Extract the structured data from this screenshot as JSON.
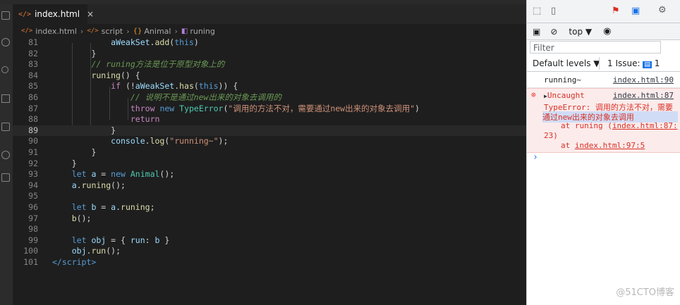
{
  "editor": {
    "tab": {
      "icon": "</>",
      "label": "index.html",
      "close": "×"
    },
    "breadcrumb": [
      {
        "icon": "</>",
        "label": "index.html"
      },
      {
        "icon": "</>",
        "label": "script"
      },
      {
        "icon": "{}",
        "label": "Animal"
      },
      {
        "icon": "◧",
        "label": "runing"
      }
    ],
    "lines": [
      {
        "n": "81",
        "ind": 6,
        "tokens": [
          [
            "var",
            "aWeakSet"
          ],
          [
            "pun",
            "."
          ],
          [
            "fn",
            "add"
          ],
          [
            "pun",
            "("
          ],
          [
            "kw",
            "this"
          ],
          [
            "pun",
            ")"
          ]
        ]
      },
      {
        "n": "82",
        "ind": 4,
        "tokens": [
          [
            "pun",
            "}"
          ]
        ]
      },
      {
        "n": "83",
        "ind": 4,
        "tokens": [
          [
            "cmt",
            "// runing方法是位于原型对象上的"
          ]
        ]
      },
      {
        "n": "84",
        "ind": 4,
        "tokens": [
          [
            "fn",
            "runing"
          ],
          [
            "pun",
            "() {"
          ]
        ]
      },
      {
        "n": "85",
        "ind": 6,
        "tokens": [
          [
            "ctl",
            "if"
          ],
          [
            "pun",
            " (!"
          ],
          [
            "var",
            "aWeakSet"
          ],
          [
            "pun",
            "."
          ],
          [
            "fn",
            "has"
          ],
          [
            "pun",
            "("
          ],
          [
            "kw",
            "this"
          ],
          [
            "pun",
            ")) {"
          ]
        ]
      },
      {
        "n": "86",
        "ind": 8,
        "tokens": [
          [
            "cmt",
            "// 说明不是通过new出来的对象去调用的"
          ]
        ]
      },
      {
        "n": "87",
        "ind": 8,
        "tokens": [
          [
            "ctl",
            "throw"
          ],
          [
            "pun",
            " "
          ],
          [
            "kw",
            "new"
          ],
          [
            "pun",
            " "
          ],
          [
            "cls",
            "TypeError"
          ],
          [
            "pun",
            "("
          ],
          [
            "str",
            "\"调用的方法不对，需要通过new出来的对象去调用\""
          ],
          [
            "pun",
            ")"
          ]
        ]
      },
      {
        "n": "88",
        "ind": 8,
        "tokens": [
          [
            "ctl",
            "return"
          ]
        ]
      },
      {
        "n": "89",
        "ind": 6,
        "tokens": [
          [
            "pun",
            "}"
          ]
        ],
        "current": true
      },
      {
        "n": "90",
        "ind": 6,
        "tokens": [
          [
            "var",
            "console"
          ],
          [
            "pun",
            "."
          ],
          [
            "fn",
            "log"
          ],
          [
            "pun",
            "("
          ],
          [
            "str",
            "\"running~\""
          ],
          [
            "pun",
            ");"
          ]
        ]
      },
      {
        "n": "91",
        "ind": 4,
        "tokens": [
          [
            "pun",
            "}"
          ]
        ]
      },
      {
        "n": "92",
        "ind": 2,
        "tokens": [
          [
            "pun",
            "}"
          ]
        ]
      },
      {
        "n": "93",
        "ind": 2,
        "tokens": [
          [
            "kw",
            "let"
          ],
          [
            "pun",
            " "
          ],
          [
            "var",
            "a"
          ],
          [
            "pun",
            " = "
          ],
          [
            "kw",
            "new"
          ],
          [
            "pun",
            " "
          ],
          [
            "cls",
            "Animal"
          ],
          [
            "pun",
            "();"
          ]
        ]
      },
      {
        "n": "94",
        "ind": 2,
        "tokens": [
          [
            "var",
            "a"
          ],
          [
            "pun",
            "."
          ],
          [
            "fn",
            "runing"
          ],
          [
            "pun",
            "();"
          ]
        ]
      },
      {
        "n": "95",
        "ind": 0,
        "tokens": []
      },
      {
        "n": "96",
        "ind": 2,
        "tokens": [
          [
            "kw",
            "let"
          ],
          [
            "pun",
            " "
          ],
          [
            "var",
            "b"
          ],
          [
            "pun",
            " = "
          ],
          [
            "var",
            "a"
          ],
          [
            "pun",
            "."
          ],
          [
            "fn",
            "runing"
          ],
          [
            "pun",
            ";"
          ]
        ]
      },
      {
        "n": "97",
        "ind": 2,
        "tokens": [
          [
            "fn",
            "b"
          ],
          [
            "pun",
            "();"
          ]
        ]
      },
      {
        "n": "98",
        "ind": 0,
        "tokens": []
      },
      {
        "n": "99",
        "ind": 2,
        "tokens": [
          [
            "kw",
            "let"
          ],
          [
            "pun",
            " "
          ],
          [
            "var",
            "obj"
          ],
          [
            "pun",
            " = { "
          ],
          [
            "var",
            "run"
          ],
          [
            "pun",
            ": "
          ],
          [
            "var",
            "b"
          ],
          [
            "pun",
            " }"
          ]
        ]
      },
      {
        "n": "100",
        "ind": 2,
        "tokens": [
          [
            "var",
            "obj"
          ],
          [
            "pun",
            "."
          ],
          [
            "fn",
            "run"
          ],
          [
            "pun",
            "();"
          ]
        ]
      },
      {
        "n": "101",
        "ind": 0,
        "tokens": [
          [
            "tagc",
            "</"
          ],
          [
            "tagn",
            "script"
          ],
          [
            "tagc",
            ">"
          ]
        ]
      }
    ]
  },
  "devtools": {
    "top_context": "top",
    "filter_placeholder": "Filter",
    "levels_label": "Default levels",
    "issues_label": "1 Issue:",
    "issues_count": "1",
    "messages": {
      "log_text": "running~",
      "log_link": "index.html:90",
      "error_label": "Uncaught",
      "error_link": "index.html:87",
      "error_line1": "TypeError: 调用的方法不对，需要",
      "error_line2": "通过new出来的对象去调用",
      "stack1_prefix": "at runing (",
      "stack1_link": "index.html:87:",
      "stack1_tail": "23)",
      "stack2_prefix": "at ",
      "stack2_link": "index.html:97:5",
      "prompt": "›"
    }
  },
  "watermark": "@51CTO博客"
}
